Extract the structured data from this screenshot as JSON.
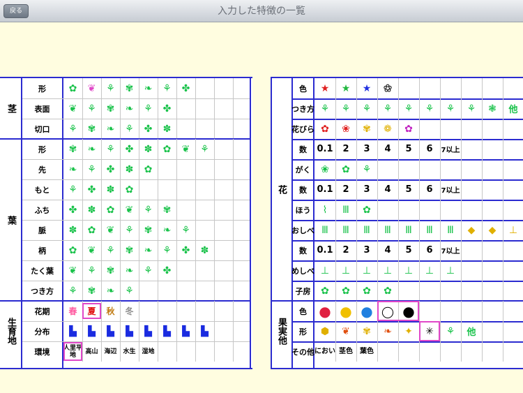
{
  "nav": {
    "back": "戻る",
    "title": "入力した特徴の一覧"
  },
  "left": {
    "groups": [
      {
        "label": "茎",
        "rows": [
          "形",
          "表面",
          "切口"
        ]
      },
      {
        "label": "葉",
        "rows": [
          "形",
          "先",
          "もと",
          "ふち",
          "脈",
          "柄",
          "たく葉",
          "つき方"
        ]
      },
      {
        "label": "生育地",
        "rows": [
          "花期",
          "分布",
          "環境"
        ]
      }
    ],
    "seasons": [
      "春",
      "夏",
      "秋",
      "冬"
    ],
    "environments": [
      "人里平地",
      "高山",
      "海辺",
      "水生",
      "湿地"
    ]
  },
  "right": {
    "groups": [
      {
        "label": "花",
        "rows": [
          "色",
          "つき方",
          "花びら",
          "数",
          "がく",
          "数",
          "ほう",
          "おしべ",
          "数",
          "めしべ",
          "子房"
        ]
      },
      {
        "label": "果実他",
        "rows": [
          "色",
          "形",
          "その他"
        ]
      }
    ],
    "numbers": [
      "0.1",
      "2",
      "3",
      "4",
      "5",
      "6",
      "7以上"
    ],
    "other_label": "他",
    "misc": [
      "におい",
      "茎色",
      "葉色"
    ]
  },
  "colors": {
    "grid_line": "#2b2bd0",
    "highlight": "#e048c8",
    "leaf_green": "#19c24a",
    "spring": "#ff5aa0",
    "summer": "#e01010",
    "autumn": "#c07a10",
    "winter": "#888888"
  }
}
